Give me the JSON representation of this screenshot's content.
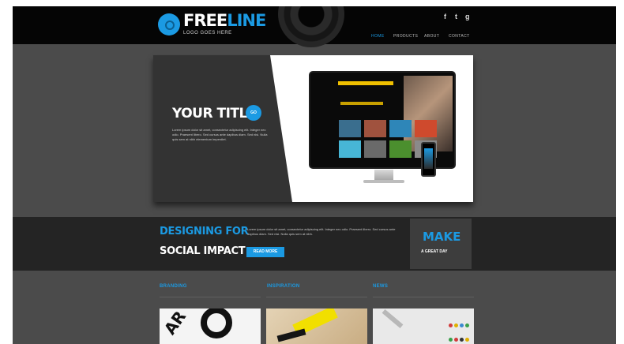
{
  "brand": {
    "part1": "FREE",
    "part2": "LINE",
    "tagline": "LOGO GOES HERE"
  },
  "social": {
    "facebook": "f",
    "twitter": "t",
    "other": "g"
  },
  "nav": [
    {
      "label": "HOME",
      "active": true
    },
    {
      "label": "PRODUCTS",
      "active": false
    },
    {
      "label": "ABOUT",
      "active": false
    },
    {
      "label": "CONTACT",
      "active": false
    }
  ],
  "hero": {
    "title": "YOUR TITLE",
    "go_label": "GO",
    "copy": "Lorem ipsum dolor sit amet, consectetur adipiscing elit. Integer nec odio. Praesent libero. Sed cursus ante dapibus diam. Sed nisi. Nulla quis sem at nibh elementum imperdiet."
  },
  "design": {
    "line1": "DESIGNING FOR",
    "line2": "SOCIAL IMPACT",
    "read_more": "READ MORE",
    "copy": "Lorem ipsum dolor sit amet, consectetur adipiscing elit. Integer nec odio. Praesent libero. Sed cursus ante dapibus diam. Sed nisi. Nulla quis sem at nibh."
  },
  "make": {
    "line1": "MAKE",
    "line2": "A GREAT DAY"
  },
  "columns": [
    {
      "title": "BRANDING"
    },
    {
      "title": "INSPIRATION"
    },
    {
      "title": "NEWS"
    }
  ],
  "colors": {
    "accent": "#1b9ae3",
    "dark": "#050505",
    "panel": "#4b4b4b"
  }
}
